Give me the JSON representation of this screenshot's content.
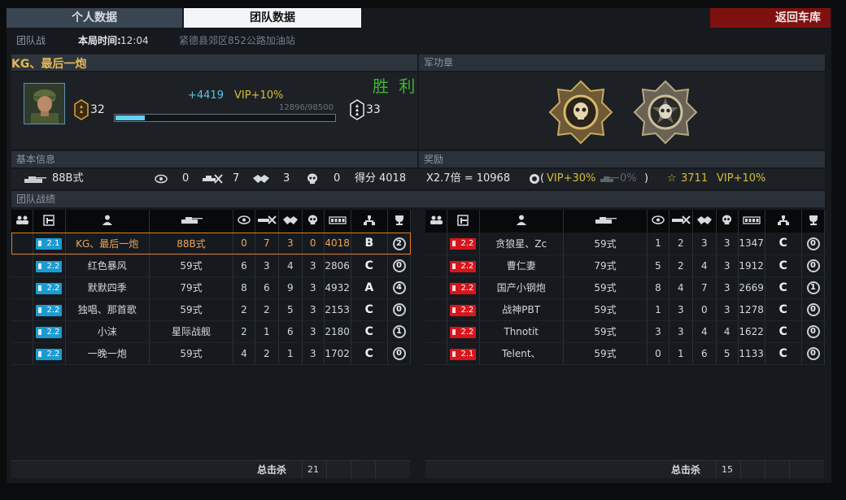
{
  "tabs": {
    "personal": "个人数据",
    "team": "团队数据"
  },
  "back_button": "返回车库",
  "info": {
    "mode": "团队战",
    "time_label": "本局时间:",
    "time_value": "12:04",
    "map": "紧德县郊区852公路加油站"
  },
  "player": {
    "name": "KG、最后一炮",
    "rank_left": "32",
    "rank_right": "33",
    "xp_gain": "+4419",
    "vip": "VIP+10%",
    "result": "胜 利",
    "xp_text": "12896/98500",
    "xp_progress": 0.131
  },
  "sections": {
    "medals": "军功章",
    "basic": "基本信息",
    "reward": "奖励",
    "team_record": "团队战绩"
  },
  "basic": {
    "tank": "88B式",
    "spot": "0",
    "kill": "7",
    "assist": "3",
    "death": "0",
    "score_label": "得分",
    "score": "4018"
  },
  "reward": {
    "multiplier": "X2.7倍 = 10968",
    "open_paren": "(",
    "vip30": "VIP+30%",
    "tank_pct": "0%",
    "close_paren": ")",
    "stars": "3711",
    "vip10": "VIP+10%"
  },
  "colors": {
    "accent_orange": "#e8a55a",
    "victory_green": "#3fb52f",
    "back_red": "#7f1010",
    "blue_team": "#1c9bd3",
    "red_team": "#d7161c",
    "xp_cyan": "#61d1f4"
  },
  "icons": [
    "players-icon",
    "clan-icon",
    "person-icon",
    "tank-icon",
    "eye-icon",
    "kill-icon",
    "handshake-icon",
    "skull-icon",
    "ammo-icon",
    "hierarchy-icon",
    "trophy-icon"
  ],
  "blue_team": [
    {
      "platoon": "2.1",
      "name": "KG、最后一炮",
      "tank": "88B式",
      "spot": "0",
      "kill": "7",
      "assist": "3",
      "death": "0",
      "score": "4018",
      "grade": "B",
      "rank": "2",
      "me": true
    },
    {
      "platoon": "2.2",
      "name": "红色暴风",
      "tank": "59式",
      "spot": "6",
      "kill": "3",
      "assist": "4",
      "death": "3",
      "score": "2806",
      "grade": "C",
      "rank": "0"
    },
    {
      "platoon": "2.2",
      "name": "默默四季",
      "tank": "79式",
      "spot": "8",
      "kill": "6",
      "assist": "9",
      "death": "3",
      "score": "4932",
      "grade": "A",
      "rank": "4"
    },
    {
      "platoon": "2.2",
      "name": "独唱、那首歌",
      "tank": "59式",
      "spot": "2",
      "kill": "2",
      "assist": "5",
      "death": "3",
      "score": "2153",
      "grade": "C",
      "rank": "0"
    },
    {
      "platoon": "2.2",
      "name": "小沫",
      "tank": "星际战舰",
      "spot": "2",
      "kill": "1",
      "assist": "6",
      "death": "3",
      "score": "2180",
      "grade": "C",
      "rank": "1"
    },
    {
      "platoon": "2.2",
      "name": "一晚一炮",
      "tank": "59式",
      "spot": "4",
      "kill": "2",
      "assist": "1",
      "death": "3",
      "score": "1702",
      "grade": "C",
      "rank": "0"
    }
  ],
  "red_team": [
    {
      "platoon": "2.2",
      "name": "贪狼星、Zc",
      "tank": "59式",
      "spot": "1",
      "kill": "2",
      "assist": "3",
      "death": "3",
      "score": "1347",
      "grade": "C",
      "rank": "0"
    },
    {
      "platoon": "2.2",
      "name": "曹仁妻",
      "tank": "79式",
      "spot": "5",
      "kill": "2",
      "assist": "4",
      "death": "3",
      "score": "1912",
      "grade": "C",
      "rank": "0"
    },
    {
      "platoon": "2.2",
      "name": "国产小钢炮",
      "tank": "59式",
      "spot": "8",
      "kill": "4",
      "assist": "7",
      "death": "3",
      "score": "2669",
      "grade": "C",
      "rank": "1"
    },
    {
      "platoon": "2.2",
      "name": "战神PBT",
      "tank": "59式",
      "spot": "1",
      "kill": "3",
      "assist": "0",
      "death": "3",
      "score": "1278",
      "grade": "C",
      "rank": "0"
    },
    {
      "platoon": "2.2",
      "name": "Thnotit",
      "tank": "59式",
      "spot": "3",
      "kill": "3",
      "assist": "4",
      "death": "4",
      "score": "1622",
      "grade": "C",
      "rank": "0"
    },
    {
      "platoon": "2.1",
      "name": "Telent、",
      "tank": "59式",
      "spot": "0",
      "kill": "1",
      "assist": "6",
      "death": "5",
      "score": "1133",
      "grade": "C",
      "rank": "0"
    }
  ],
  "totals": {
    "label": "总击杀",
    "blue": "21",
    "red": "15"
  }
}
